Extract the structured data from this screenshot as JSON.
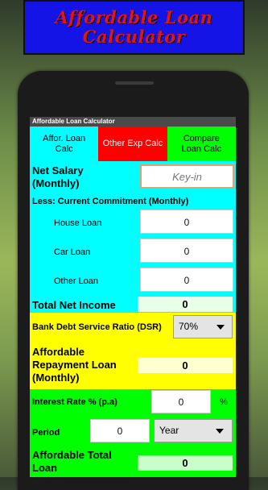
{
  "promo": {
    "line1": "Affordable Loan",
    "line2": "Calculator"
  },
  "app": {
    "title": "Affordable Loan Calculator"
  },
  "tabs": [
    {
      "line1": "Affor. Loan",
      "line2": "Calc"
    },
    {
      "label": "Other Exp Calc"
    },
    {
      "line1": "Compare",
      "line2": "Loan Calc"
    }
  ],
  "net_salary": {
    "line1": "Net Salary",
    "line2": "(Monthly)",
    "placeholder": "Key-in"
  },
  "less_label": "Less: Current Commitment (Monthly)",
  "commitments": [
    {
      "label": "House Loan",
      "value": "0"
    },
    {
      "label": "Car Loan",
      "value": "0"
    },
    {
      "label": "Other Loan",
      "value": "0"
    }
  ],
  "total_net_income": {
    "label": "Total Net Income",
    "value": "0"
  },
  "dsr": {
    "label": "Bank Debt Service Ratio (DSR)",
    "selected": "70%"
  },
  "affordable_repayment": {
    "line1": "Affordable",
    "line2": "Repayment Loan",
    "line3": "(Monthly)",
    "value": "0"
  },
  "interest": {
    "label": "Interest Rate % (p.a)",
    "value": "0",
    "unit": "%"
  },
  "period": {
    "label": "Period",
    "value": "0",
    "unit_selected": "Year"
  },
  "affordable_total": {
    "line1": "Affordable Total",
    "line2": "Loan",
    "value": "0"
  },
  "colors": {
    "cyan": "#00ffff",
    "yellow": "#ffff00",
    "green": "#00ff00",
    "red": "#ff0000",
    "promo_bg": "#1414e6",
    "promo_text": "#e01515"
  }
}
